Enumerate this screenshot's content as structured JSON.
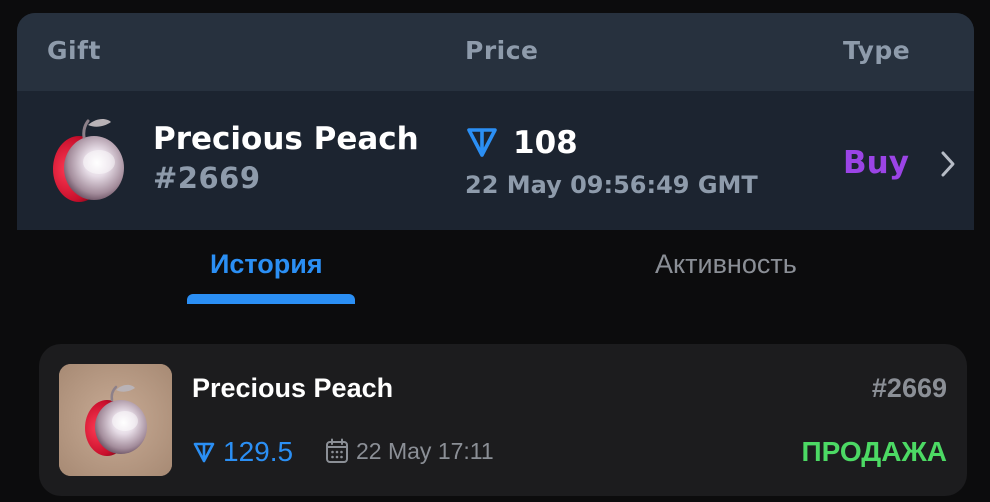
{
  "table": {
    "headers": {
      "gift": "Gift",
      "price": "Price",
      "type": "Type"
    },
    "row": {
      "gift_name": "Precious Peach",
      "gift_number": "#2669",
      "gift_icon": "peach-icon",
      "currency_icon": "ton-icon",
      "price": "108",
      "date": "22 May 09:56:49 GMT",
      "type": "Buy",
      "chevron_icon": "chevron-right-icon"
    }
  },
  "tabs": [
    {
      "label": "История",
      "active": true
    },
    {
      "label": "Активность",
      "active": false
    }
  ],
  "history": {
    "items": [
      {
        "name": "Precious Peach",
        "number": "#2669",
        "price": "129.5",
        "date": "22 May 17:11",
        "status": "ПРОДАЖА",
        "thumbnail_icon": "peach-icon",
        "currency_icon": "ton-icon",
        "date_icon": "calendar-icon"
      }
    ]
  },
  "colors": {
    "accent_blue": "#2b8ff4",
    "buy_purple": "#9b44e6",
    "sale_green": "#4cd964",
    "muted_gray": "#8e9bab"
  }
}
